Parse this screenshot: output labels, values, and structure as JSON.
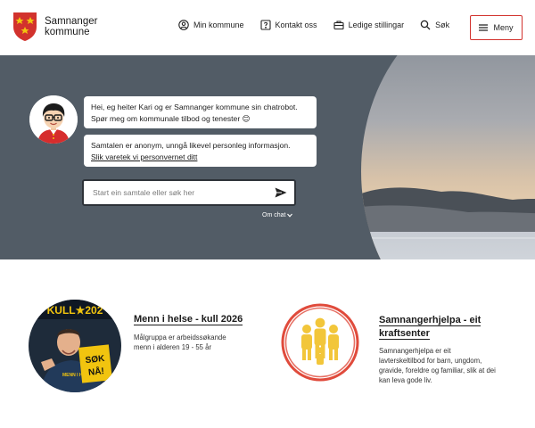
{
  "header": {
    "brand_line1": "Samnanger",
    "brand_line2": "kommune",
    "nav": [
      {
        "label": "Min kommune",
        "icon": "user-circle-icon"
      },
      {
        "label": "Kontakt oss",
        "icon": "question-box-icon"
      },
      {
        "label": "Ledige stillingar",
        "icon": "briefcase-icon"
      },
      {
        "label": "Søk",
        "icon": "search-icon"
      }
    ],
    "menu_label": "Meny"
  },
  "chat": {
    "greeting": "Hei, eg heiter Kari og er Samnanger kommune sin chatrobot. Spør meg om kommunale tilbod og tenester 😊",
    "privacy_text": "Samtalen er anonym, unngå likevel personleg informasjon.",
    "privacy_link": "Slik varetek vi personvernet ditt",
    "input_placeholder": "Start ein samtale eller søk her",
    "about_label": "Om chat"
  },
  "cards": [
    {
      "title": "Menn i helse - kull 2026",
      "text": "Målgruppa er arbeidssøkande menn i alderen 19 - 55 år",
      "image_text_top": "KULL★202",
      "image_sign": "SØK NÅ!",
      "image_shirt": "MENN I HELSE"
    },
    {
      "title": "Samnangerhjelpa - eit kraftsenter",
      "text": "Samnangerhjelpa er eit lavterskeltilbod for barn, ungdom, gravide, foreldre og familiar, slik at dei kan leva gode liv."
    }
  ],
  "colors": {
    "accent_red": "#d2322d",
    "hero_bg": "#525c66",
    "logo_yellow": "#f1c40f"
  }
}
